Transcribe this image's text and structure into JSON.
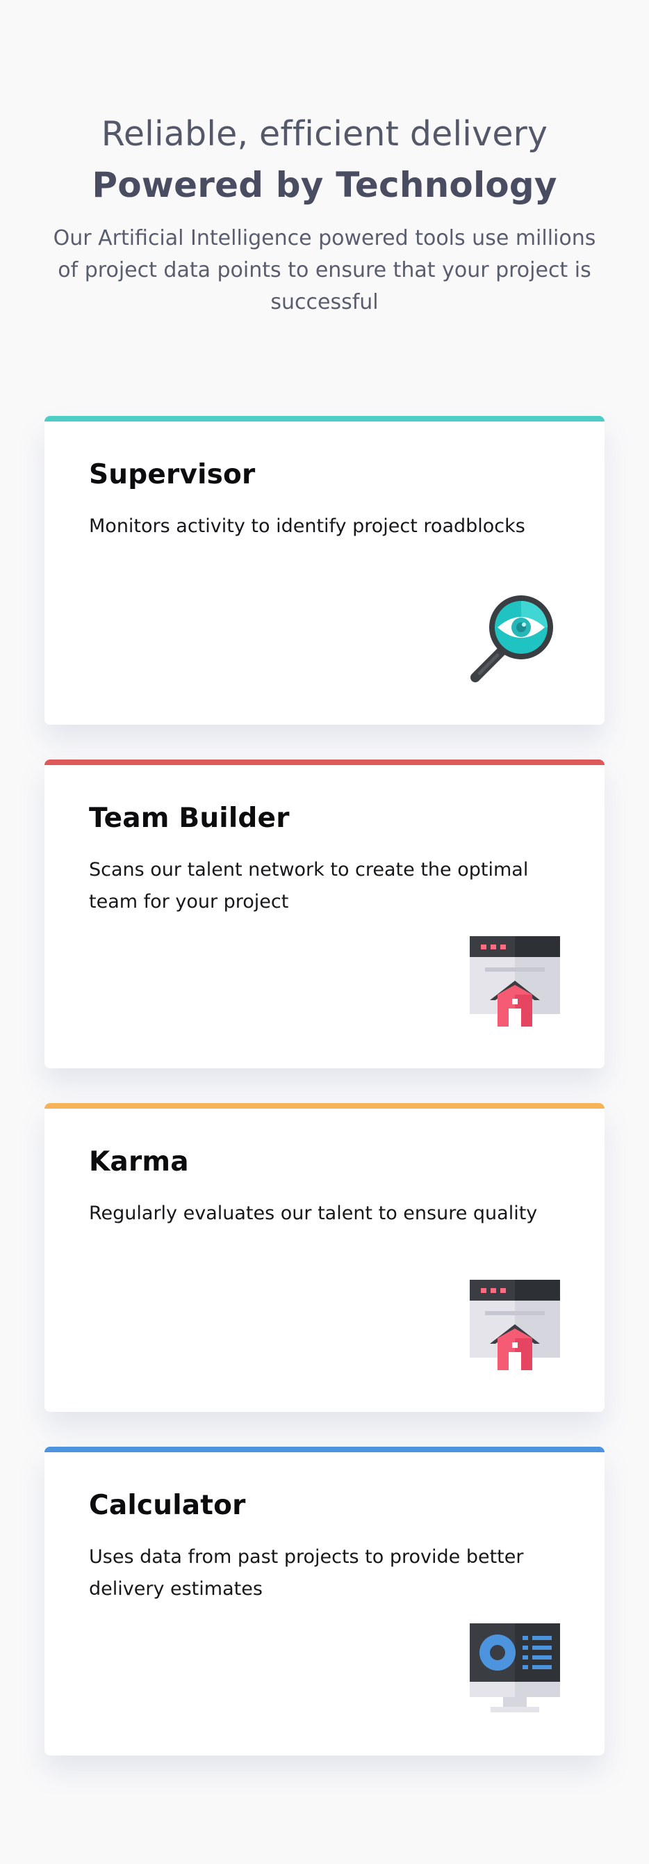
{
  "header": {
    "subtitle": "Reliable, efficient delivery",
    "title": "Powered by Technology",
    "lead": "Our Artificial Intelligence powered tools use millions of project data points to ensure that your project is successful"
  },
  "cards": [
    {
      "title": "Supervisor",
      "description": "Monitors activity to identify project roadblocks",
      "accent": "#4ecdc4",
      "icon": "magnifier-eye-icon"
    },
    {
      "title": "Team Builder",
      "description": "Scans our talent network to create the optimal team for your project",
      "accent": "#de5a5a",
      "icon": "browser-home-icon"
    },
    {
      "title": "Karma",
      "description": "Regularly evaluates our talent to ensure quality",
      "accent": "#f6b35a",
      "icon": "browser-home-icon"
    },
    {
      "title": "Calculator",
      "description": "Uses data from past projects to provide better delivery estimates",
      "accent": "#4d94de",
      "icon": "monitor-chart-icon"
    }
  ]
}
